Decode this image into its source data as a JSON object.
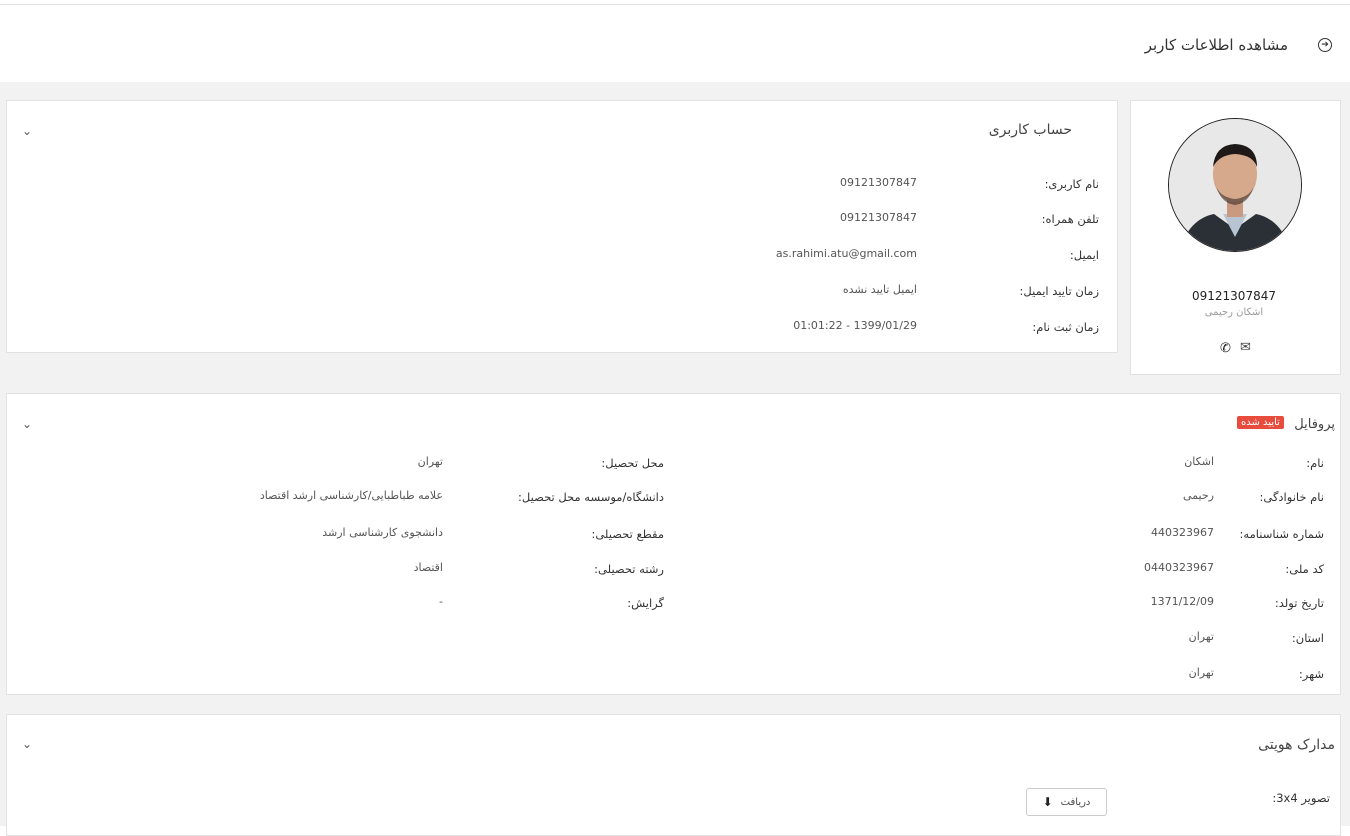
{
  "page": {
    "title": "مشاهده اطلاعات کاربر"
  },
  "profile_card": {
    "username": "09121307847",
    "full_name": "اشکان رحیمی",
    "phone_icon": "phone-icon",
    "mail_icon": "mail-icon"
  },
  "account": {
    "title": "حساب کاربری",
    "rows": [
      {
        "label": "نام کاربری:",
        "value": "09121307847"
      },
      {
        "label": "تلفن همراه:",
        "value": "09121307847"
      },
      {
        "label": "ایمیل:",
        "value": "as.rahimi.atu@gmail.com"
      },
      {
        "label": "زمان تایید ایمیل:",
        "value": "ایمیل تایید نشده"
      },
      {
        "label": "زمان ثبت نام:",
        "value": "1399/01/29 - 01:01:22"
      }
    ]
  },
  "profile": {
    "title": "پروفایل",
    "badge": "تایید شده",
    "right_rows": [
      {
        "label": "نام:",
        "value": "اشکان"
      },
      {
        "label": "نام خانوادگی:",
        "value": "رحیمی"
      },
      {
        "label": "شماره شناسنامه:",
        "value": "440323967"
      },
      {
        "label": "کد ملی:",
        "value": "0440323967"
      },
      {
        "label": "تاریخ تولد:",
        "value": "1371/12/09"
      },
      {
        "label": "استان:",
        "value": "تهران"
      },
      {
        "label": "شهر:",
        "value": "تهران"
      }
    ],
    "left_rows": [
      {
        "label": "محل تحصیل:",
        "value": "تهران"
      },
      {
        "label": "دانشگاه/موسسه محل تحصیل:",
        "value": "علامه طباطبایی/کارشناسی ارشد اقتصاد"
      },
      {
        "label": "مقطع تحصیلی:",
        "value": "دانشجوی کارشناسی ارشد"
      },
      {
        "label": "رشته تحصیلی:",
        "value": "اقتصاد"
      },
      {
        "label": "گرایش:",
        "value": "-"
      }
    ]
  },
  "documents": {
    "title": "مدارک هویتی",
    "photo_label": "تصویر 3x4:",
    "download_label": "دریافت"
  }
}
